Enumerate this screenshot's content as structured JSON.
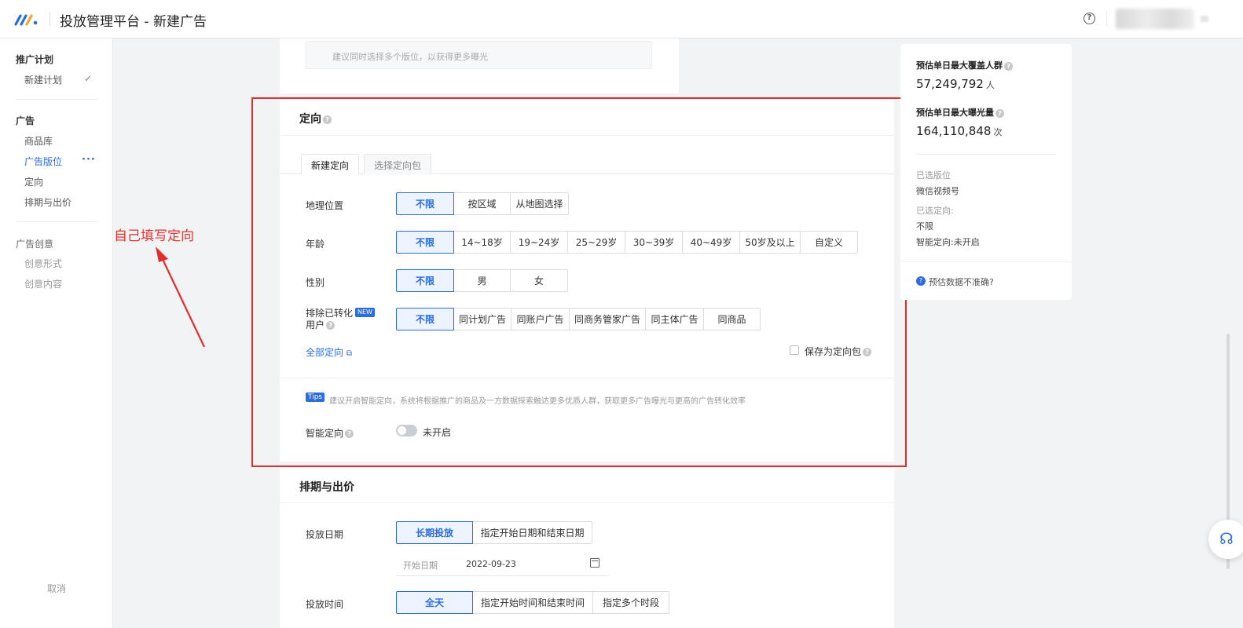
{
  "header": {
    "title": "投放管理平台 - 新建广告",
    "help_symbol": "?"
  },
  "sidebar": {
    "groups": [
      {
        "label": "推广计划",
        "items": [
          {
            "label": "新建计划"
          }
        ]
      },
      {
        "label": "广告",
        "items": [
          {
            "label": "商品库"
          },
          {
            "label": "广告版位"
          },
          {
            "label": "定向"
          },
          {
            "label": "排期与出价"
          }
        ]
      },
      {
        "label": "广告创意",
        "items": [
          {
            "label": "创意形式"
          },
          {
            "label": "创意内容"
          }
        ]
      }
    ],
    "cancel": "取消"
  },
  "annotation": {
    "text": "自己填写定向",
    "color": "#e02d2d"
  },
  "placement_hint": "建议同时选择多个版位，以获得更多曝光",
  "targeting": {
    "title": "定向",
    "tabs": [
      "新建定向",
      "选择定向包"
    ],
    "rows": [
      {
        "label": "地理位置",
        "options": [
          "不限",
          "按区域",
          "从地图选择"
        ],
        "selected": 0
      },
      {
        "label": "年龄",
        "options": [
          "不限",
          "14~18岁",
          "19~24岁",
          "25~29岁",
          "30~39岁",
          "40~49岁",
          "50岁及以上",
          "自定义"
        ],
        "selected": 0
      },
      {
        "label": "性别",
        "options": [
          "不限",
          "男",
          "女"
        ],
        "selected": 0
      },
      {
        "label_line1": "排除已转化",
        "label_line2": "用户",
        "badge": "NEW",
        "options": [
          "不限",
          "同计划广告",
          "同账户广告",
          "同商务管家广告",
          "同主体广告",
          "同商品"
        ],
        "selected": 0
      }
    ],
    "all_targeting_link": "全部定向",
    "save_as_package": "保存为定向包",
    "tips_badge": "Tips",
    "tips_text": "建议开启智能定向，系统将根据推广的商品及一方数据探索触达更多优质人群，获取更多广告曝光与更高的广告转化效率",
    "smart_label": "智能定向",
    "smart_state": "未开启"
  },
  "schedule": {
    "title": "排期与出价",
    "date_label": "投放日期",
    "date_options": [
      "长期投放",
      "指定开始日期和结束日期"
    ],
    "date_selected": 0,
    "start_date_placeholder": "开始日期",
    "start_date_value": "2022-09-23",
    "time_label": "投放时间",
    "time_options": [
      "全天",
      "指定开始时间和结束时间",
      "指定多个时段"
    ],
    "time_selected": 0
  },
  "estimate_panel": {
    "reach_label": "预估单日最大覆盖人群",
    "reach_value": "57,249,792",
    "reach_unit": "人",
    "impr_label": "预估单日最大曝光量",
    "impr_value": "164,110,848",
    "impr_unit": "次",
    "placement_label": "已选版位",
    "placement_value": "微信视频号",
    "targeting_label": "已选定向:",
    "targeting_value": "不限",
    "smart_value": "智能定向:未开启",
    "help_link": "预估数据不准确?"
  },
  "colors": {
    "accent": "#2b6ce0",
    "annotation": "#e02d2d"
  }
}
